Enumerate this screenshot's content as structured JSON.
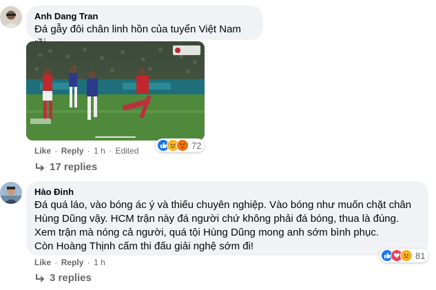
{
  "comments": [
    {
      "author": "Anh Dang Tran",
      "text": "Đá gẫy đôi chân linh hồn của tuyển Việt Nam rồi",
      "actions": {
        "like": "Like",
        "reply": "Reply",
        "time": "1 h",
        "edited": "Edited"
      },
      "reaction_count": "72",
      "replies_label": "17 replies"
    },
    {
      "author": "Hào Đinh",
      "lines": [
        "Đá quá láo, vào bóng ác ý và thiếu chuyên nghiệp. Vào bóng như muốn chặt chân",
        "Hùng Dũng vậy. HCM trận này đá người chứ không phải đá bóng, thua là đúng.",
        "Xem trận mà nóng cả người, quá tội Hùng Dũng mong anh sớm bình phục.",
        "Còn Hoàng Thịnh cấm thi đấu giải nghệ sớm đi!"
      ],
      "actions": {
        "like": "Like",
        "reply": "Reply",
        "time": "1 h"
      },
      "reaction_count": "81",
      "replies_label": "3 replies"
    }
  ],
  "colors": {
    "bubble": "#f0f2f5",
    "meta": "#65676b",
    "like_blue": "#1877f2",
    "love_red": "#f33e58",
    "sad_yellow": "#f7b125"
  },
  "icons": [
    "like-reaction-icon",
    "sad-reaction-icon",
    "angry-reaction-icon",
    "love-reaction-icon",
    "reply-arrow-icon"
  ]
}
